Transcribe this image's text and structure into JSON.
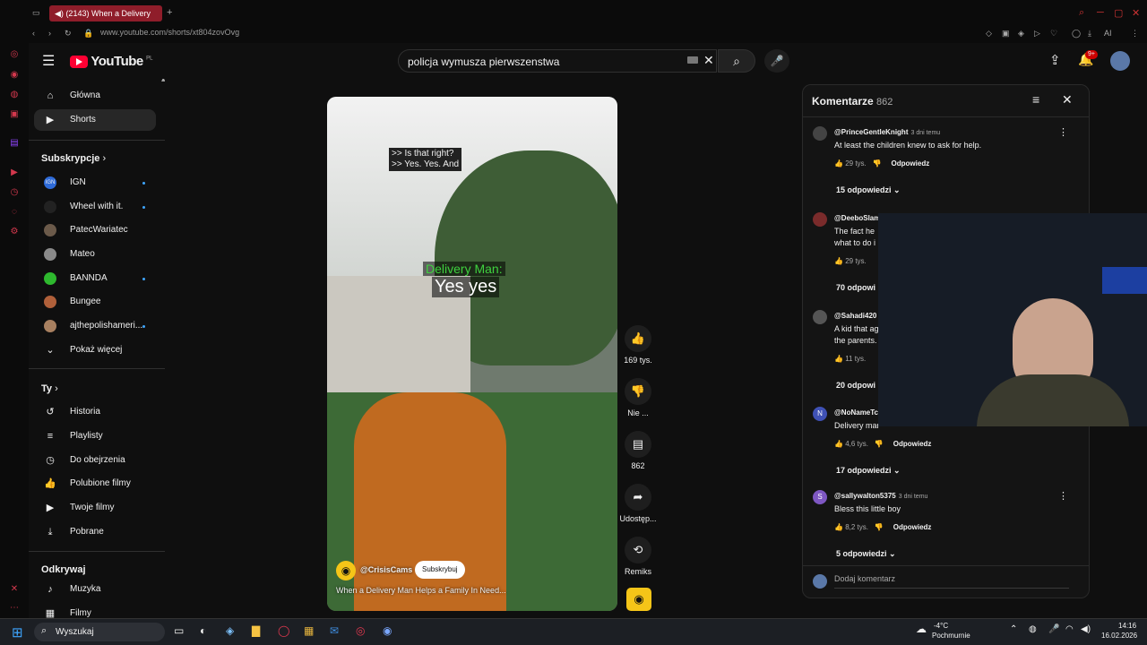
{
  "browser": {
    "tab_title": "(2143) When a Delivery",
    "url": "www.youtube.com/shorts/xt804zovOvg"
  },
  "youtube": {
    "logo": "YouTube",
    "region": "PL",
    "search_query": "policja wymusza pierwszenstwa",
    "notification_count": "9+"
  },
  "guide": {
    "main": [
      {
        "label": "Główna",
        "icon": "home-icon"
      },
      {
        "label": "Shorts",
        "icon": "shorts-icon"
      }
    ],
    "subscriptions_header": "Subskrypcje",
    "subscriptions": [
      {
        "label": "IGN",
        "dot": true
      },
      {
        "label": "Wheel with it.",
        "dot": true
      },
      {
        "label": "PatecWariatec",
        "dot": false
      },
      {
        "label": "Mateo",
        "dot": false
      },
      {
        "label": "BANNDA",
        "dot": true
      },
      {
        "label": "Bungee",
        "dot": false
      },
      {
        "label": "ajthepolishameri...",
        "dot": true
      }
    ],
    "show_more": "Pokaż więcej",
    "you_header": "Ty",
    "you": [
      {
        "label": "Historia",
        "icon": "history-icon"
      },
      {
        "label": "Playlisty",
        "icon": "playlist-icon"
      },
      {
        "label": "Do obejrzenia",
        "icon": "watch-later-icon"
      },
      {
        "label": "Polubione filmy",
        "icon": "like-icon"
      },
      {
        "label": "Twoje filmy",
        "icon": "video-icon"
      },
      {
        "label": "Pobrane",
        "icon": "download-icon"
      }
    ],
    "explore_header": "Odkrywaj",
    "explore": [
      {
        "label": "Muzyka",
        "icon": "music-icon"
      },
      {
        "label": "Filmy",
        "icon": "film-icon"
      }
    ]
  },
  "short": {
    "caption_line1": ">> Is that right?",
    "caption_line2": ">> Yes. Yes. And",
    "speaker": "Delivery Man:",
    "speaker_text": "Yes yes",
    "channel": "@CrisisCams",
    "subscribe": "Subskrybuj",
    "title": "When a Delivery Man Helps a Family In Need...",
    "likes": "169 tys.",
    "dislike": "Nie ...",
    "comments": "862",
    "share": "Udostęp...",
    "remix": "Remiks"
  },
  "comments_panel": {
    "title": "Komentarze",
    "count": "862",
    "reply_label": "Odpowiedz",
    "add_placeholder": "Dodaj komentarz",
    "items": [
      {
        "author": "@PrinceGentleKnight",
        "time": "3 dni temu",
        "text": "At least the children knew to ask for help.",
        "likes": "29 tys.",
        "replies": "15 odpowiedzi",
        "avatar_color": "#444"
      },
      {
        "author": "@DeeboSlam",
        "time": "",
        "text": "The fact he",
        "text2": "what to do i",
        "likes": "29 tys.",
        "replies": "70 odpowi",
        "avatar_color": "#7a2b2b"
      },
      {
        "author": "@Sahadi420",
        "time": "",
        "text": "A kid that ag",
        "text2": "the parents.",
        "likes": "11 tys.",
        "replies": "20 odpowi",
        "avatar_color": "#555"
      },
      {
        "author": "@NoNameTc",
        "time": "",
        "text": "Delivery mar",
        "likes": "4,6 tys.",
        "replies": "17 odpowiedzi",
        "avatar_letter": "N",
        "avatar_color": "#3f51b5"
      },
      {
        "author": "@sallywalton5375",
        "time": "3 dni temu",
        "text": "Bless this little boy",
        "likes": "8,2 tys.",
        "replies": "5 odpowiedzi",
        "avatar_letter": "S",
        "avatar_color": "#7e57c2"
      }
    ]
  },
  "taskbar": {
    "search": "Wyszukaj",
    "weather_temp": "-4°C",
    "weather_desc": "Pochmurnie",
    "time": "14:16",
    "date": "16.02.2026"
  },
  "colors": {
    "accent": "#ff0033",
    "link": "#3ea6ff",
    "opera": "#d3384d"
  }
}
